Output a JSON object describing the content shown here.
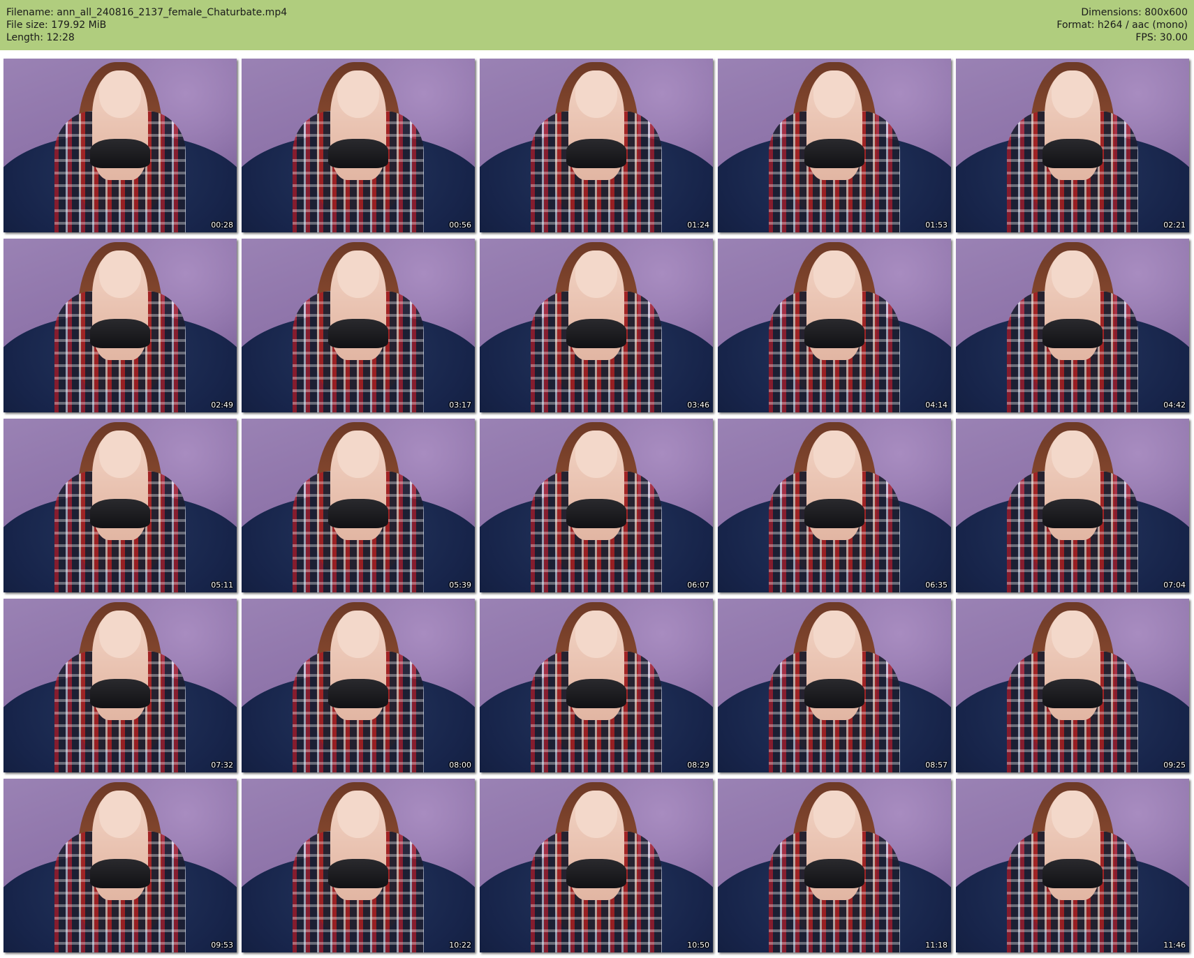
{
  "header": {
    "filename_label": "Filename: ann_all_240816_2137_female_Chaturbate.mp4",
    "filesize_label": "File size: 179.92 MiB",
    "length_label": "Length: 12:28",
    "dimensions_label": "Dimensions: 800x600",
    "format_label": "Format: h264 / aac (mono)",
    "fps_label": "FPS: 30.00",
    "background_color": "#b0cd7e"
  },
  "thumbnails": [
    {
      "timestamp": "00:28"
    },
    {
      "timestamp": "00:56"
    },
    {
      "timestamp": "01:24"
    },
    {
      "timestamp": "01:53"
    },
    {
      "timestamp": "02:21"
    },
    {
      "timestamp": "02:49"
    },
    {
      "timestamp": "03:17"
    },
    {
      "timestamp": "03:46"
    },
    {
      "timestamp": "04:14"
    },
    {
      "timestamp": "04:42"
    },
    {
      "timestamp": "05:11"
    },
    {
      "timestamp": "05:39"
    },
    {
      "timestamp": "06:07"
    },
    {
      "timestamp": "06:35"
    },
    {
      "timestamp": "07:04"
    },
    {
      "timestamp": "07:32"
    },
    {
      "timestamp": "08:00"
    },
    {
      "timestamp": "08:29"
    },
    {
      "timestamp": "08:57"
    },
    {
      "timestamp": "09:25"
    },
    {
      "timestamp": "09:53"
    },
    {
      "timestamp": "10:22"
    },
    {
      "timestamp": "10:50"
    },
    {
      "timestamp": "11:18"
    },
    {
      "timestamp": "11:46"
    }
  ]
}
